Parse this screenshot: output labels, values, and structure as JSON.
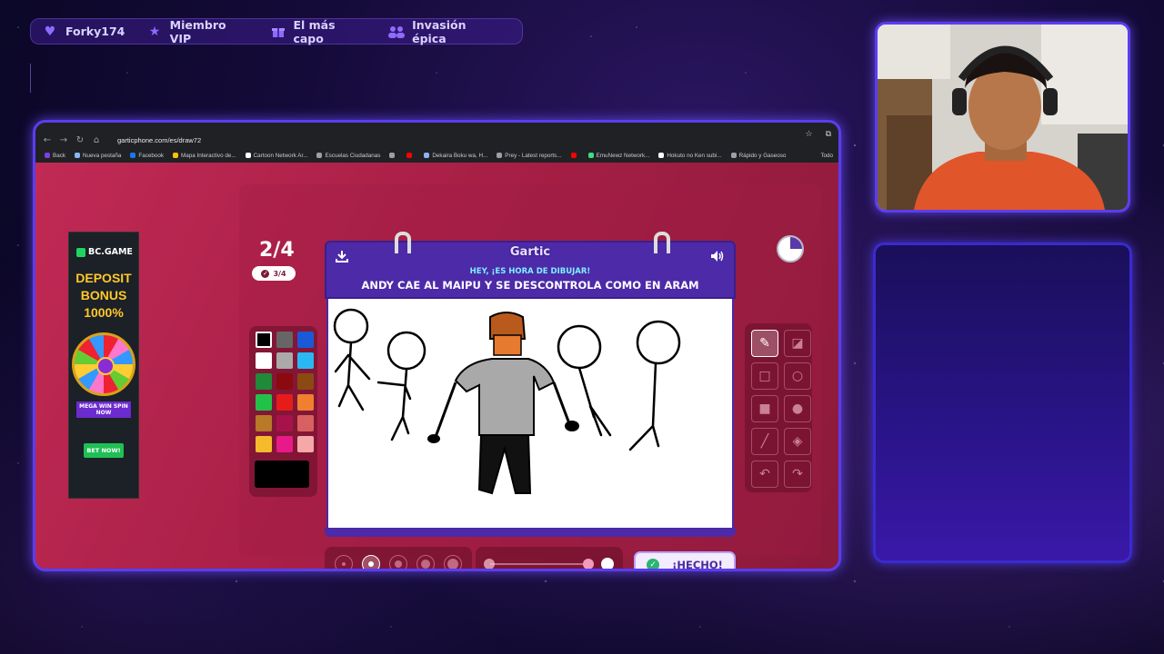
{
  "topbar": {
    "items": [
      {
        "label": "Forky174",
        "icon": "heart-icon"
      },
      {
        "label": "Miembro VIP",
        "icon": "star-icon"
      },
      {
        "label": "El más capo",
        "icon": "gift-icon"
      },
      {
        "label": "Invasión épica",
        "icon": "users-icon"
      }
    ]
  },
  "browser": {
    "url": "garticphone.com/es/draw72",
    "bookmarks": [
      {
        "label": "Back",
        "color": "#7b3fe4"
      },
      {
        "label": "Nueva pestaña",
        "color": "#8ab4f8"
      },
      {
        "label": "Facebook",
        "color": "#1877f2"
      },
      {
        "label": "Mapa Interactivo de...",
        "color": "#f4c20d"
      },
      {
        "label": "Cartoon Network Ar...",
        "color": "#ffffff"
      },
      {
        "label": "Escuelas Ciudadanas",
        "color": "#9aa0a6"
      },
      {
        "label": "",
        "color": "#9aa0a6"
      },
      {
        "label": "",
        "color": "#ff0000"
      },
      {
        "label": "Dekaira Boku wa, H...",
        "color": "#8ab4f8"
      },
      {
        "label": "Prey - Latest reports...",
        "color": "#9aa0a6"
      },
      {
        "label": "",
        "color": "#ff0000"
      },
      {
        "label": "EmuNewz Network...",
        "color": "#3ddc84"
      },
      {
        "label": "Hokuto no Ken subi...",
        "color": "#ffffff"
      },
      {
        "label": "Rápido y Gaseoso",
        "color": "#9aa0a6"
      }
    ],
    "all_bookmarks": "Todo"
  },
  "ad": {
    "brand": "BC.GAME",
    "headline_1": "DEPOSIT",
    "headline_2": "BONUS",
    "headline_3": "1000%",
    "tagline": "MEGA WIN SPIN NOW",
    "cta": "BET NOW!"
  },
  "game": {
    "round": "2/4",
    "done_count": "3/4",
    "logo": "Gartic",
    "hey": "HEY, ¡ES HORA DE DIBUJAR!",
    "prompt": "ANDY CAE AL MAIPU Y SE DESCONTROLA COMO EN ARAM",
    "done_button": "¡HECHO!",
    "timer_progress": 0.25,
    "palette": [
      "#000000",
      "#666666",
      "#1a5ad6",
      "#ffffff",
      "#aaaaaa",
      "#2ab8f5",
      "#1e8a3a",
      "#8a0a10",
      "#8a4a12",
      "#22c24a",
      "#e81b1b",
      "#f08030",
      "#b87a28",
      "#a8124a",
      "#d86060",
      "#f5bb2a",
      "#e81a8a",
      "#f5a8a8"
    ],
    "selected_color": "#000000",
    "tools": [
      "pencil-icon",
      "eraser-icon",
      "rect-outline-icon",
      "circle-outline-icon",
      "rect-fill-icon",
      "circle-fill-icon",
      "line-icon",
      "bucket-icon",
      "undo-icon",
      "redo-icon"
    ],
    "brush_sizes": [
      1,
      2,
      3,
      4,
      5
    ],
    "selected_size": 2
  }
}
